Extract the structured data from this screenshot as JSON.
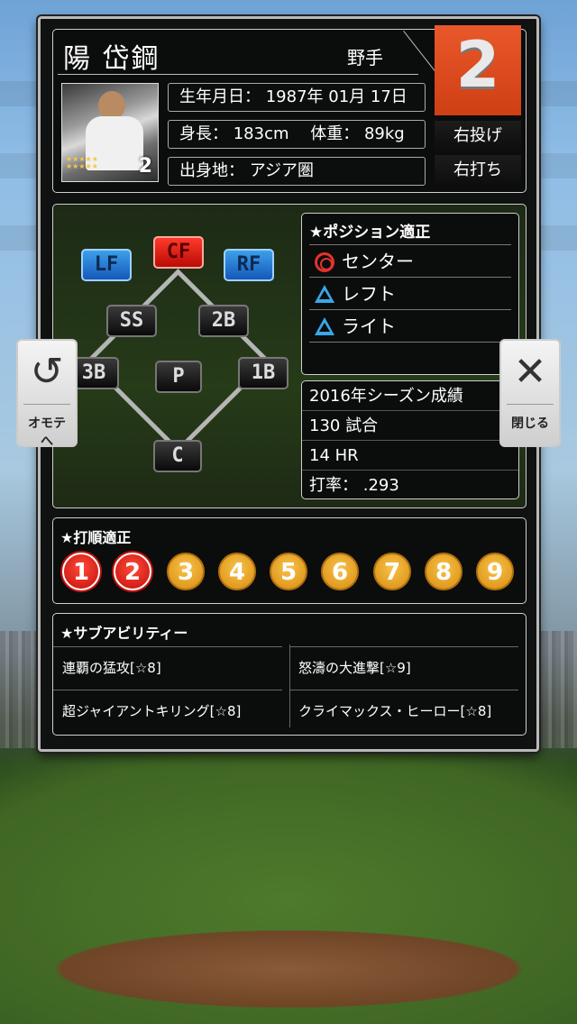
{
  "player": {
    "name": "陽 岱鋼",
    "position_label": "野手",
    "uniform_number": "2",
    "birthdate": "生年月日： 1987年 01月 17日",
    "height_weight": "身長： 183cm 　体重： 89kg",
    "birthplace": "出身地： アジア圏",
    "throws": "右投げ",
    "bats": "右打ち",
    "photo_number": "2"
  },
  "field": {
    "positions": [
      "LF",
      "CF",
      "RF",
      "SS",
      "2B",
      "3B",
      "P",
      "1B",
      "C"
    ],
    "highlight": {
      "CF": "red",
      "LF": "blue",
      "RF": "blue"
    }
  },
  "position_aptitude": {
    "title": "★ポジション適正",
    "items": [
      {
        "mark": "double-circle",
        "label": "センター"
      },
      {
        "mark": "triangle",
        "label": "レフト"
      },
      {
        "mark": "triangle",
        "label": "ライト"
      }
    ]
  },
  "season": {
    "title": "2016年シーズン成績",
    "games": "130 試合",
    "hr": "14 HR",
    "avg": "打率： .293"
  },
  "batting_order": {
    "title": "★打順適正",
    "numbers": [
      "1",
      "2",
      "3",
      "4",
      "5",
      "6",
      "7",
      "8",
      "9"
    ],
    "active": [
      "1",
      "2"
    ]
  },
  "sub_ability": {
    "title": "★サブアビリティー",
    "items": [
      "連覇の猛攻[☆8]",
      "怒濤の大進撃[☆9]",
      "超ジャイアントキリング[☆8]",
      "クライマックス・ヒーロー[☆8]"
    ]
  },
  "nav": {
    "front_label": "オモテへ",
    "close_label": "閉じる"
  },
  "colors": {
    "accent_orange": "#e0501f",
    "gold": "#f2c230",
    "active_red": "#e5322b",
    "outfield_blue": "#2a7fd6"
  }
}
